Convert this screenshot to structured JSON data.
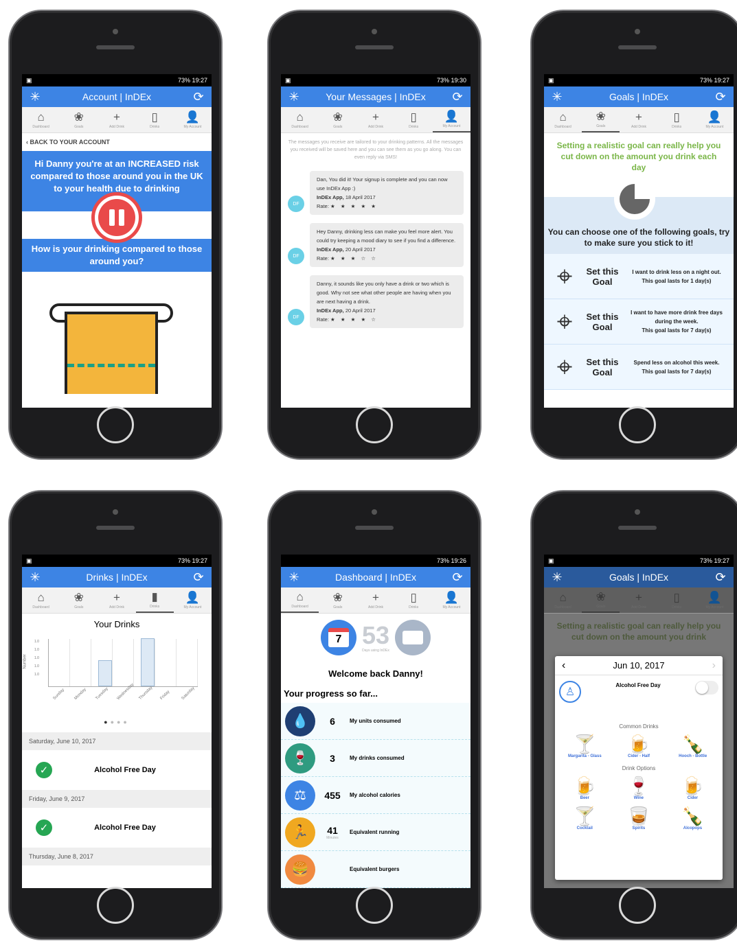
{
  "status_times": {
    "p1": "19:27",
    "p2": "19:30",
    "p3": "19:27",
    "p4": "19:27",
    "p5": "19:26",
    "p6": "19:27"
  },
  "battery": "73%",
  "tabs": [
    "Dashboard",
    "Goals",
    "Add Drink",
    "Drinks",
    "My Account"
  ],
  "p1": {
    "title": "Account | InDEx",
    "back": "BACK TO YOUR ACCOUNT",
    "risk": "Hi Danny you're at an INCREASED risk compared to those around you in the UK to your health due to drinking",
    "question": "How is your drinking compared to those around you?"
  },
  "p2": {
    "title": "Your Messages | InDEx",
    "intro": "The messages you receive are tailored to your drinking patterns. All the messages you received will be saved here and you can see them as you go along. You can even reply via SMS!",
    "messages": [
      {
        "text": "Dan, You did it! Your signup is complete and you can now use InDEx App :)",
        "sender": "InDEx App,",
        "date": "18 April 2017",
        "rate": "Rate:",
        "stars": "★ ★ ★ ★ ★",
        "av": "DF"
      },
      {
        "text": "Hey Danny, drinking less can make you feel more alert. You could try keeping a mood diary to see if you find a difference.",
        "sender": "InDEx App,",
        "date": "20 April 2017",
        "rate": "Rate:",
        "stars": "★ ★ ★ ☆ ☆",
        "av": "DF"
      },
      {
        "text": "Danny, it sounds like you only have a drink or two which is good. Why not see what other people are having when you are next having a drink.",
        "sender": "InDEx App,",
        "date": "20 April 2017",
        "rate": "Rate:",
        "stars": "★ ★ ★ ★ ☆",
        "av": "DF"
      }
    ]
  },
  "p3": {
    "title": "Goals | InDEx",
    "intro": "Setting a realistic goal can really help you cut down on the amount you drink each day",
    "choose": "You can choose one of the following goals, try to make sure you stick to it!",
    "goals": [
      {
        "set": "Set this Goal",
        "desc": "I want to drink less on a night out.",
        "dur": "This goal lasts for 1 day(s)"
      },
      {
        "set": "Set this Goal",
        "desc": "I want to have more drink free days during the week.",
        "dur": "This goal lasts for 7 day(s)"
      },
      {
        "set": "Set this Goal",
        "desc": "Spend less on alcohol this week.",
        "dur": "This goal lasts for 7 day(s)"
      }
    ]
  },
  "p4": {
    "title": "Drinks | InDEx",
    "heading": "Your Drinks",
    "ylabel": "Number",
    "ticks": [
      "1.0",
      "1.0",
      "1.0",
      "1.0",
      "1.0"
    ],
    "days": [
      "Sunday",
      "Monday",
      "Tuesday",
      "Wednesday",
      "Thursday",
      "Friday",
      "Saturday"
    ],
    "entries": [
      {
        "date": "Saturday, June 10, 2017",
        "label": "Alcohol Free Day"
      },
      {
        "date": "Friday, June 9, 2017",
        "label": "Alcohol Free Day"
      },
      {
        "date": "Thursday, June 8, 2017",
        "label": ""
      }
    ]
  },
  "p5": {
    "title": "Dashboard | InDEx",
    "cal": "7",
    "days": "53",
    "days_sub": "Days using InDEx",
    "welcome": "Welcome back Danny!",
    "progress": "Your progress so far...",
    "rows": [
      {
        "n": "6",
        "label": "My units consumed",
        "sub": ""
      },
      {
        "n": "3",
        "label": "My drinks consumed",
        "sub": ""
      },
      {
        "n": "455",
        "label": "My alcohol calories",
        "sub": ""
      },
      {
        "n": "41",
        "label": "Equivalent running",
        "sub": "Minutes"
      },
      {
        "n": "",
        "label": "Equivalent burgers",
        "sub": ""
      }
    ]
  },
  "p6": {
    "title": "Goals | InDEx",
    "bg_intro": "Setting a realistic goal can really help you cut down on the amount you drink",
    "date": "Jun 10, 2017",
    "afd": "Alcohol Free Day",
    "common": "Common Drinks",
    "options": "Drink Options",
    "common_drinks": [
      {
        "name": "Margarita - Glass",
        "sub": "",
        "icon": "🍸"
      },
      {
        "name": "Cider - Half",
        "sub": "",
        "icon": "🍺"
      },
      {
        "name": "Hooch - Bottle",
        "sub": "",
        "icon": "🍾"
      }
    ],
    "drinks": [
      {
        "name": "Beer",
        "icon": "🍺"
      },
      {
        "name": "Wine",
        "icon": "🍷"
      },
      {
        "name": "Cider",
        "icon": "🍺"
      },
      {
        "name": "Cocktail",
        "icon": "🍸"
      },
      {
        "name": "Spirits",
        "icon": "🥃"
      },
      {
        "name": "Alcopops",
        "icon": "🍾"
      }
    ]
  },
  "colors": {
    "primary": "#3d84e4",
    "green": "#7ab648",
    "check": "#26a653"
  }
}
